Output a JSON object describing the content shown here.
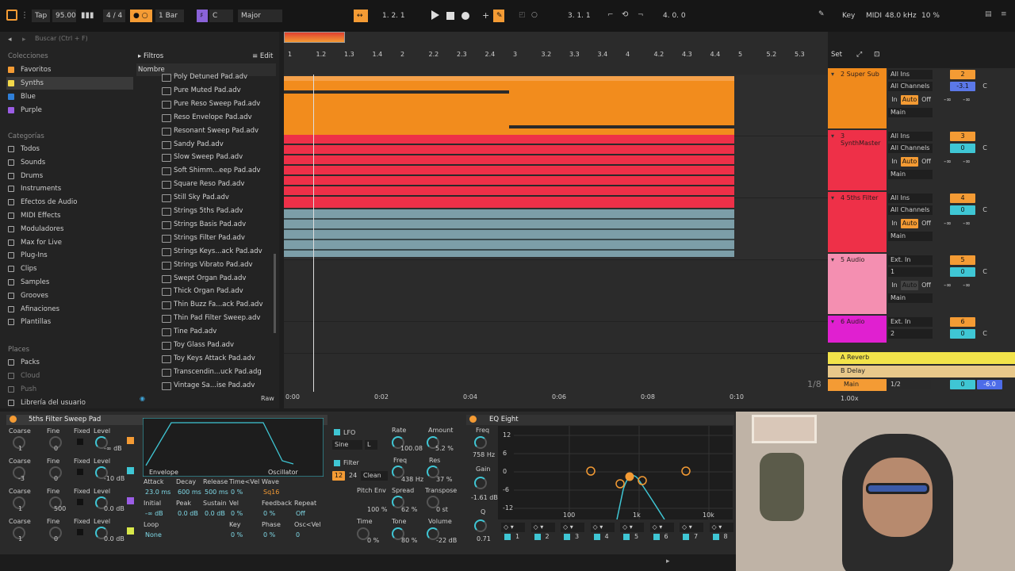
{
  "transport": {
    "tap": "Tap",
    "tempo": "95.00",
    "meter": "4 / 4",
    "quantize": "1 Bar",
    "key": "C",
    "scale": "Major",
    "pos": "1. 2. 1",
    "loop_start": "3. 1. 1",
    "loop_len": "4. 0. 0",
    "key_btn": "Key",
    "midi_btn": "MIDI",
    "sample_rate": "48.0 kHz",
    "cpu": "10 %"
  },
  "browser": {
    "search_placeholder": "Buscar (Ctrl + F)",
    "collections_header": "Colecciones",
    "collections": [
      {
        "label": "Favoritos",
        "color": "#f49b34"
      },
      {
        "label": "Synths",
        "color": "#f2d84a"
      },
      {
        "label": "Blue",
        "color": "#2f7fd8"
      },
      {
        "label": "Purple",
        "color": "#9b5de5"
      }
    ],
    "categories_header": "Categorías",
    "categories": [
      "Todos",
      "Sounds",
      "Drums",
      "Instruments",
      "Efectos de Audio",
      "MIDI Effects",
      "Moduladores",
      "Max for Live",
      "Plug-Ins",
      "Clips",
      "Samples",
      "Grooves",
      "Afinaciones",
      "Plantillas"
    ],
    "places_header": "Places",
    "places": [
      "Packs",
      "Cloud",
      "Push",
      "Librería del usuario"
    ],
    "filters": "Filtros",
    "edit": "Edit",
    "name_col": "Nombre",
    "raw": "Raw",
    "files": [
      "Poly Detuned Pad.adv",
      "Pure Muted Pad.adv",
      "Pure Reso Sweep Pad.adv",
      "Reso Envelope Pad.adv",
      "Resonant Sweep Pad.adv",
      "Sandy Pad.adv",
      "Slow Sweep Pad.adv",
      "Soft Shimm...eep Pad.adv",
      "Square Reso Pad.adv",
      "Still Sky Pad.adv",
      "Strings 5ths Pad.adv",
      "Strings Basis Pad.adv",
      "Strings Filter Pad.adv",
      "Strings Keys...ack Pad.adv",
      "Strings Vibrato Pad.adv",
      "Swept Organ Pad.adv",
      "Thick Organ Pad.adv",
      "Thin Buzz Fa...ack Pad.adv",
      "Thin Pad Filter Sweep.adv",
      "Tine Pad.adv",
      "Toy Glass Pad.adv",
      "Toy Keys Attack Pad.adv",
      "Transcendin...uck Pad.adg",
      "Vintage Sa...ise Pad.adv"
    ]
  },
  "arrangement": {
    "ruler": [
      "1",
      "1.2",
      "1.3",
      "1.4",
      "2",
      "2.2",
      "2.3",
      "2.4",
      "3",
      "3.2",
      "3.3",
      "3.4",
      "4",
      "4.2",
      "4.3",
      "4.4",
      "5",
      "5.2",
      "5.3"
    ],
    "time": [
      "0:00",
      "0:02",
      "0:04",
      "0:06",
      "0:08",
      "0:10"
    ],
    "set": "Set",
    "grid": "1/8",
    "zoom": "1.00x"
  },
  "mixer": {
    "tracks": [
      {
        "name": "2 Super Sub",
        "color": "#f08a1c",
        "in": "All Ins",
        "ch": "All Channels",
        "num": "2",
        "vol": "-3.1",
        "pan": "C"
      },
      {
        "name": "3 SynthMaster",
        "color": "#ee3048",
        "in": "All Ins",
        "ch": "All Channels",
        "num": "3",
        "vol": "0",
        "pan": "C"
      },
      {
        "name": "4 5ths Filter",
        "color": "#ee3048",
        "in": "All Ins",
        "ch": "All Channels",
        "num": "4",
        "vol": "0",
        "pan": "C"
      },
      {
        "name": "5 Audio",
        "color": "#f48fb1",
        "in": "Ext. In",
        "ch": "1",
        "num": "5",
        "vol": "0",
        "pan": "C"
      },
      {
        "name": "6 Audio",
        "color": "#e020d0",
        "in": "Ext. In",
        "ch": "2",
        "num": "6",
        "vol": "0",
        "pan": "C"
      }
    ],
    "returns": [
      {
        "name": "A Reverb",
        "letter": "A"
      },
      {
        "name": "B Delay",
        "letter": "B"
      }
    ],
    "main": {
      "name": "Main",
      "fraction": "1/2",
      "vol": "0",
      "db": "-6.0"
    },
    "monitor": [
      "In",
      "Auto",
      "Off"
    ],
    "out": "Main",
    "inf": "-∞"
  },
  "device1": {
    "title": "5ths Filter Sweep Pad",
    "osc": [
      {
        "coarse": "1",
        "fine": "0",
        "level": "-∞ dB"
      },
      {
        "coarse": "-3",
        "fine": "0",
        "level": "-10 dB"
      },
      {
        "coarse": "1",
        "fine": "500",
        "level": "0.0 dB"
      },
      {
        "coarse": "1",
        "fine": "0",
        "level": "0.0 dB"
      }
    ],
    "labels": {
      "coarse": "Coarse",
      "fine": "Fine",
      "fixed": "Fixed",
      "level": "Level",
      "envelope": "Envelope",
      "oscillator": "Oscillator",
      "attack": "Attack",
      "decay": "Decay",
      "release": "Release",
      "timevel": "Time<Vel",
      "wave": "Wave",
      "initial": "Initial",
      "peak": "Peak",
      "sustain": "Sustain",
      "vel": "Vel",
      "feedback": "Feedback",
      "repeat": "Repeat",
      "loop": "Loop",
      "key": "Key",
      "phase": "Phase",
      "oscvel": "Osc<Vel"
    },
    "env": {
      "attack": "23.0 ms",
      "decay": "600 ms",
      "release": "500 ms",
      "timevel": "0 %",
      "wave": "Sq16",
      "initial": "-∞ dB",
      "peak": "0.0 dB",
      "sustain": "0.0 dB",
      "vel": "0 %",
      "feedback": "0 %",
      "repeat": "Off",
      "loop": "None",
      "key": "0 %",
      "phase": "0 %",
      "oscvel": "0"
    },
    "lfo": {
      "label": "LFO",
      "wave": "Sine",
      "lr": "L",
      "rate_label": "Rate",
      "rate": "100.08",
      "amount_label": "Amount",
      "amount": "5.2 %"
    },
    "filter": {
      "label": "Filter",
      "type": "12",
      "slope": "24",
      "mode": "Clean",
      "freq_label": "Freq",
      "freq": "438 Hz",
      "res_label": "Res",
      "res": "37 %",
      "pitchenv_label": "Pitch Env",
      "pitchenv": "100 %",
      "spread_label": "Spread",
      "spread": "62 %",
      "transpose_label": "Transpose",
      "transpose": "0 st",
      "time_label": "Time",
      "time": "0 %",
      "tone_label": "Tone",
      "tone": "80 %",
      "volume_label": "Volume",
      "volume": "-22 dB"
    }
  },
  "eq": {
    "title": "EQ Eight",
    "freq_label": "Freq",
    "freq": "758 Hz",
    "gain_label": "Gain",
    "gain": "-1.61 dB",
    "q_label": "Q",
    "q": "0.71",
    "db_ticks": [
      "12",
      "6",
      "0",
      "-6",
      "-12"
    ],
    "hz_ticks": [
      "100",
      "1k",
      "10k"
    ],
    "bands": [
      "1",
      "2",
      "3",
      "4",
      "5",
      "6",
      "7",
      "8"
    ]
  }
}
